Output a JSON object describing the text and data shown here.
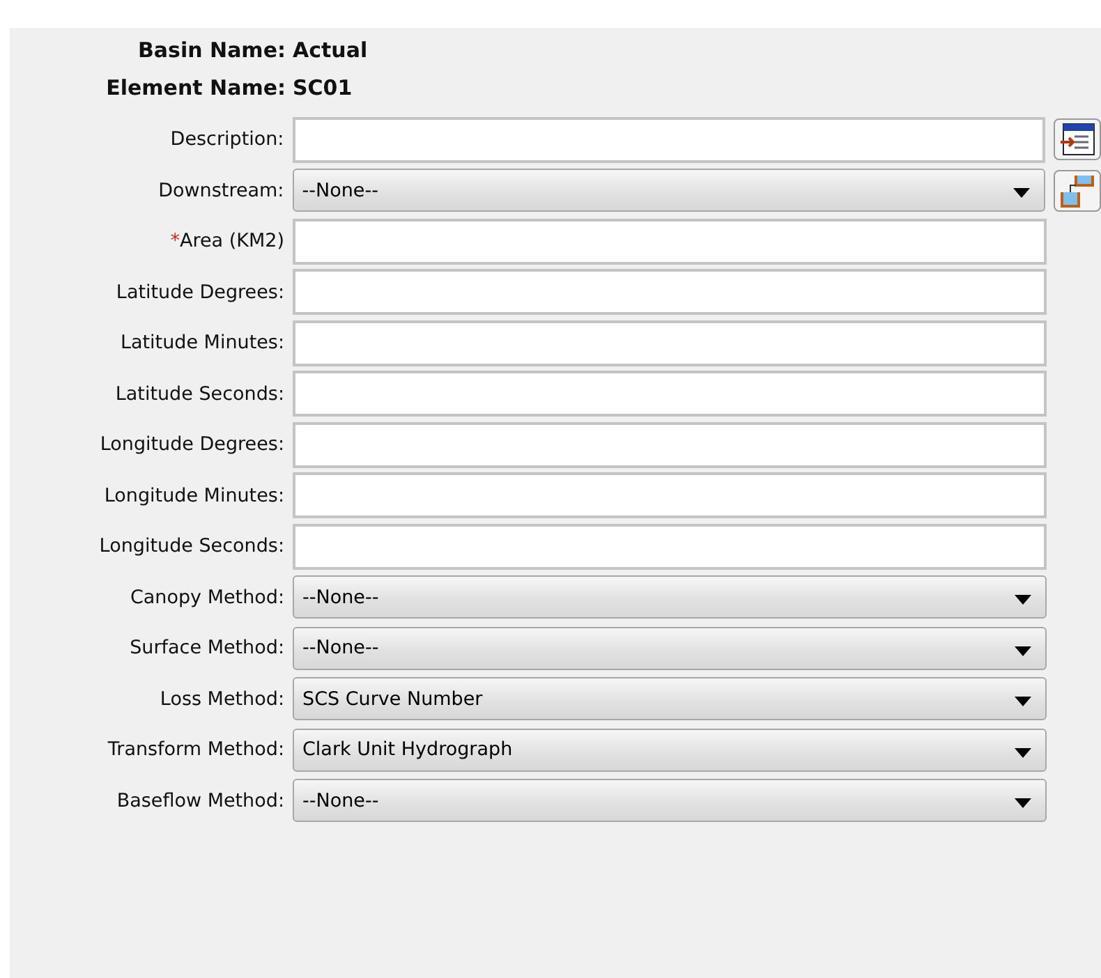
{
  "header": [
    {
      "label": "Basin Name:",
      "value": "Actual"
    },
    {
      "label": "Element Name:",
      "value": "SC01"
    }
  ],
  "fields": [
    {
      "kind": "text",
      "label": "Description:"
    },
    {
      "kind": "select",
      "label": "Downstream:",
      "value": "--None--"
    },
    {
      "kind": "text",
      "marker": "*",
      "label": "Area (KM2)"
    },
    {
      "kind": "text",
      "label": "Latitude Degrees:"
    },
    {
      "kind": "text",
      "label": "Latitude Minutes:"
    },
    {
      "kind": "text",
      "label": "Latitude Seconds:"
    },
    {
      "kind": "text",
      "label": "Longitude Degrees:"
    },
    {
      "kind": "text",
      "label": "Longitude Minutes:"
    },
    {
      "kind": "text",
      "label": "Longitude Seconds:"
    },
    {
      "kind": "select",
      "label": "Canopy Method:",
      "value": "--None--"
    },
    {
      "kind": "select",
      "label": "Surface Method:",
      "value": "--None--"
    },
    {
      "kind": "select",
      "label": "Loss Method:",
      "value": "SCS Curve Number"
    },
    {
      "kind": "select",
      "label": "Transform Method:",
      "value": "Clark Unit Hydrograph"
    },
    {
      "kind": "select",
      "label": "Baseflow Method:",
      "value": "--None--"
    }
  ]
}
